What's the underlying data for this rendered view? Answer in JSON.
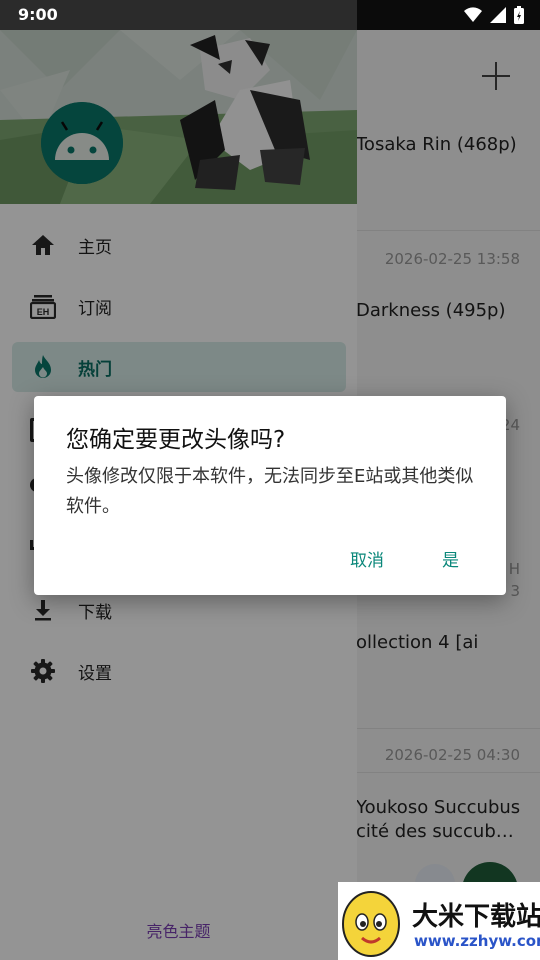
{
  "status_bar": {
    "time": "9:00"
  },
  "background_list": {
    "items": [
      {
        "title": "Tosaka Rin (468p)",
        "date": ""
      },
      {
        "title": "",
        "date": "2026-02-25 13:58"
      },
      {
        "title": "Darkness (495p)",
        "date": ""
      },
      {
        "title": "",
        "date": "24"
      },
      {
        "title": "H",
        "date": "3"
      },
      {
        "title": "ollection 4 [ai",
        "date": ""
      },
      {
        "title": "",
        "date": "2026-02-25 04:30"
      },
      {
        "title": "Youkoso Succubus",
        "date": ""
      },
      {
        "title": "cité des succub…",
        "date": ""
      }
    ]
  },
  "drawer": {
    "nav_items": [
      {
        "label": "主页",
        "icon": "home-icon"
      },
      {
        "label": "订阅",
        "icon": "eh-subscription-icon"
      },
      {
        "label": "热门",
        "icon": "fire-icon",
        "active": true
      },
      {
        "label": "下载",
        "icon": "download-icon"
      },
      {
        "label": "设置",
        "icon": "gear-icon"
      }
    ],
    "theme_toggle": "亮色主题"
  },
  "dialog": {
    "title": "您确定要更改头像吗?",
    "message": "头像修改仅限于本软件，无法同步至E站或其他类似软件。",
    "cancel": "取消",
    "confirm": "是"
  },
  "watermark": {
    "text": "大米下载站",
    "url": "www.zzhyw.com"
  },
  "colors": {
    "accent": "#0a877a",
    "active_bg": "#d8ece8",
    "theme_text": "#7b3fb3"
  }
}
